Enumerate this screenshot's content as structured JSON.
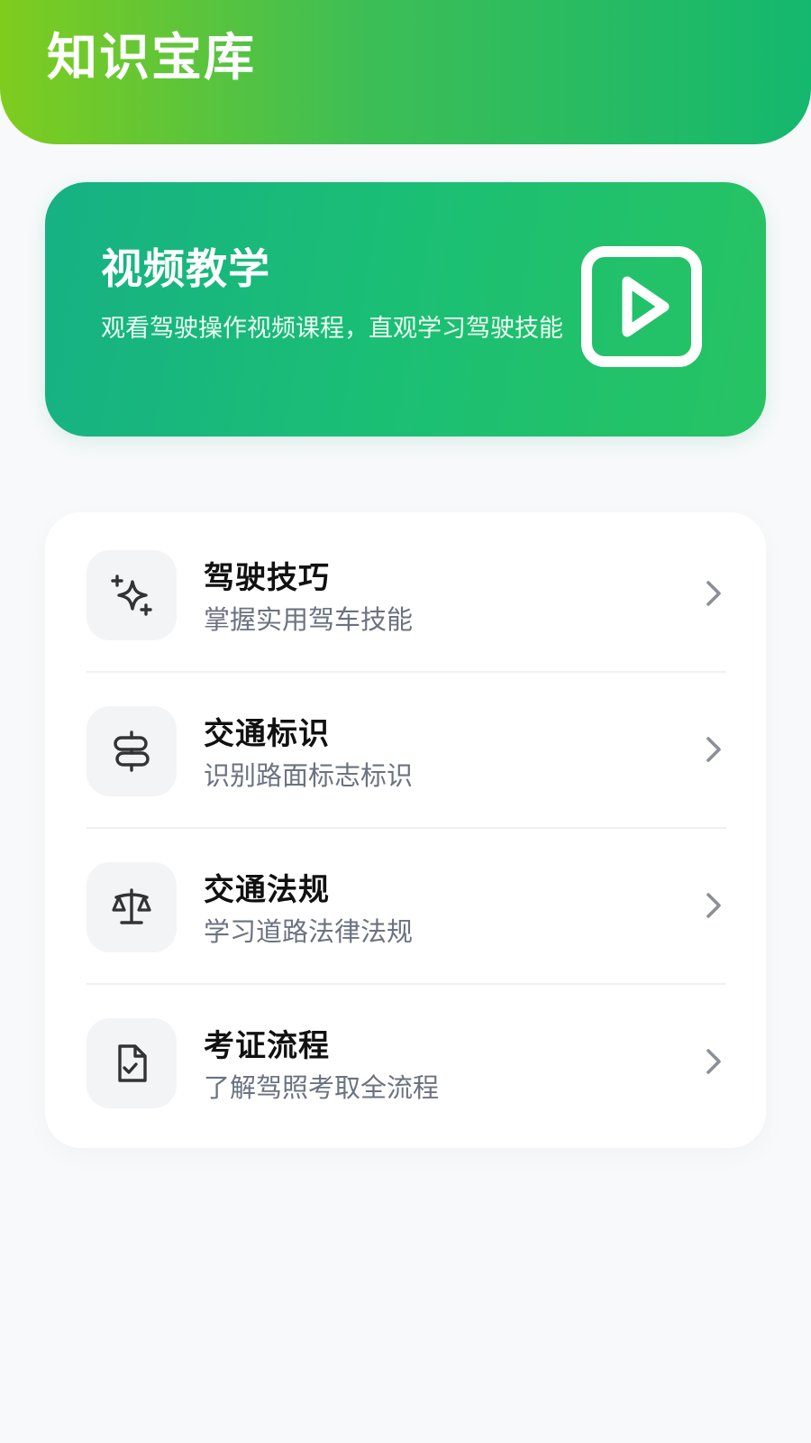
{
  "header": {
    "title": "知识宝库"
  },
  "video_card": {
    "title": "视频教学",
    "description": "观看驾驶操作视频课程，直观学习驾驶技能",
    "icon": "play-icon"
  },
  "menu": {
    "items": [
      {
        "title": "驾驶技巧",
        "subtitle": "掌握实用驾车技能",
        "icon": "sparkles-icon"
      },
      {
        "title": "交通标识",
        "subtitle": "识别路面标志标识",
        "icon": "signpost-icon"
      },
      {
        "title": "交通法规",
        "subtitle": "学习道路法律法规",
        "icon": "scale-icon"
      },
      {
        "title": "考证流程",
        "subtitle": "了解驾照考取全流程",
        "icon": "document-check-icon"
      }
    ]
  },
  "colors": {
    "header_gradient_start": "#7fcc1e",
    "header_gradient_end": "#14b86f",
    "card_gradient_start": "#16b184",
    "card_gradient_end": "#27c363",
    "page_background": "#f7f9fb"
  }
}
